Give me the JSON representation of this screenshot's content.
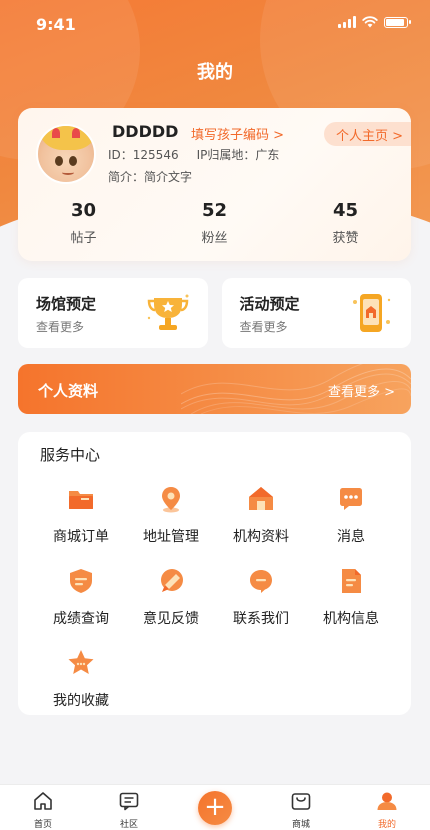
{
  "status_bar": {
    "time": "9:41"
  },
  "header": {
    "title": "我的"
  },
  "profile": {
    "username": "DDDDD",
    "fill_child_code": "填写孩子编码 >",
    "home_link": "个人主页 >",
    "id_text": "ID：125546",
    "ip_text": "IP归属地：广东",
    "bio_text": "简介：简介文字",
    "stats": [
      {
        "value": "30",
        "label": "帖子"
      },
      {
        "value": "52",
        "label": "粉丝"
      },
      {
        "value": "45",
        "label": "获赞"
      }
    ]
  },
  "bookings": [
    {
      "title": "场馆预定",
      "sub": "查看更多",
      "icon": "trophy-icon"
    },
    {
      "title": "活动预定",
      "sub": "查看更多",
      "icon": "phone-booking-icon"
    }
  ],
  "banner": {
    "title": "个人资料",
    "more": "查看更多 >"
  },
  "services": {
    "title": "服务中心",
    "items": [
      {
        "label": "商城订单",
        "icon": "folder-icon"
      },
      {
        "label": "地址管理",
        "icon": "location-pin-icon"
      },
      {
        "label": "机构资料",
        "icon": "home-icon"
      },
      {
        "label": "消息",
        "icon": "chat-icon"
      },
      {
        "label": "成绩查询",
        "icon": "shield-icon"
      },
      {
        "label": "意见反馈",
        "icon": "pencil-icon"
      },
      {
        "label": "联系我们",
        "icon": "message-icon"
      },
      {
        "label": "机构信息",
        "icon": "document-icon"
      },
      {
        "label": "我的收藏",
        "icon": "star-icon"
      }
    ]
  },
  "tabbar": {
    "items": [
      {
        "label": "首页",
        "icon": "home-outline-icon"
      },
      {
        "label": "社区",
        "icon": "community-icon"
      },
      {
        "label": "",
        "icon": "plus-icon"
      },
      {
        "label": "商城",
        "icon": "mall-icon"
      },
      {
        "label": "我的",
        "icon": "user-icon"
      }
    ],
    "plus_symbol": "+"
  },
  "colors": {
    "accent": "#f26a2b",
    "accent_light": "#f7a35e",
    "bg": "#f4f4f6"
  }
}
